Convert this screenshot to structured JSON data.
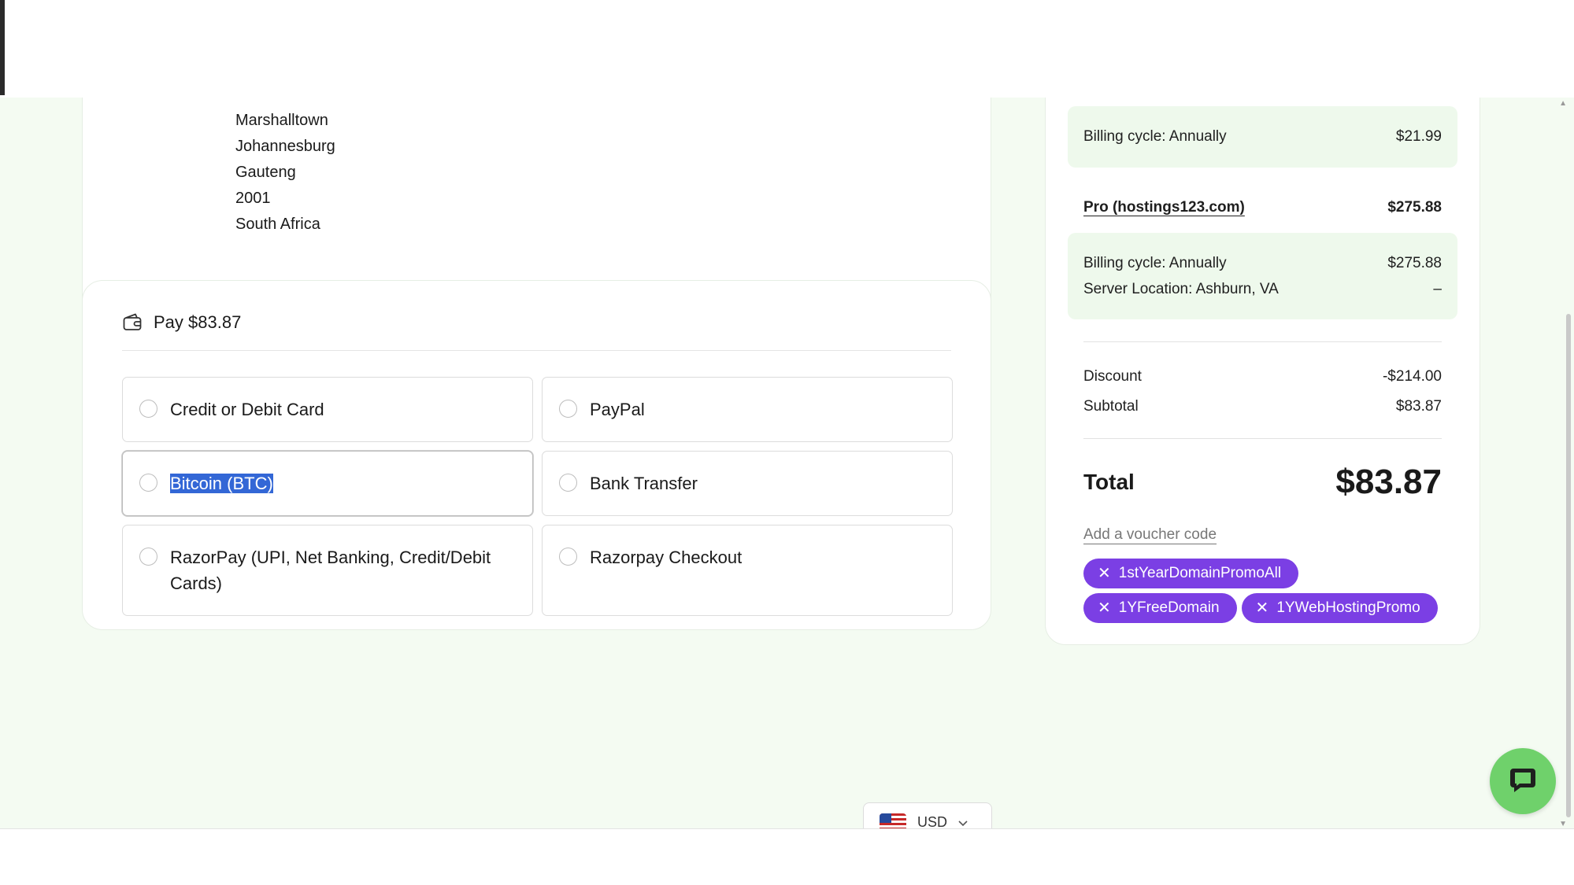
{
  "address": {
    "lines": [
      "Marshalltown",
      "Johannesburg",
      "Gauteng",
      "2001",
      "South Africa"
    ]
  },
  "payment": {
    "title": "Pay $83.87",
    "methods": [
      {
        "label": "Credit or Debit Card"
      },
      {
        "label": "PayPal"
      },
      {
        "label": "Bitcoin (BTC)"
      },
      {
        "label": "Bank Transfer"
      },
      {
        "label": "RazorPay (UPI, Net Banking, Credit/Debit Cards)"
      },
      {
        "label": "Razorpay Checkout"
      }
    ]
  },
  "summary": {
    "item1_billing": {
      "label": "Billing cycle: Annually",
      "value": "$21.99"
    },
    "item2": {
      "name": "Pro (hostings123.com)",
      "price": "$275.88"
    },
    "item2_billing": {
      "label": "Billing cycle: Annually",
      "value": "$275.88"
    },
    "item2_location": {
      "label": "Server Location: Ashburn, VA",
      "value": "–"
    },
    "discount": {
      "label": "Discount",
      "value": "-$214.00"
    },
    "subtotal": {
      "label": "Subtotal",
      "value": "$83.87"
    },
    "total": {
      "label": "Total",
      "value": "$83.87"
    },
    "voucher_link": "Add a voucher code",
    "promo_codes": [
      "1stYearDomainPromoAll",
      "1YFreeDomain",
      "1YWebHostingPromo"
    ]
  },
  "currency": {
    "selected": "USD"
  },
  "colors": {
    "accent": "#7b3fe4",
    "page_bg": "#f4fbf2",
    "chat": "#6fd16b",
    "selection": "#3367d6"
  },
  "icons": {
    "wallet": "wallet-icon",
    "chat": "chat-icon",
    "remove": "close-icon",
    "dropdown": "chevron-down-icon",
    "flag": "us-flag-icon"
  }
}
